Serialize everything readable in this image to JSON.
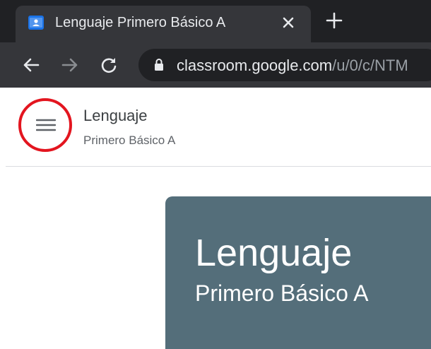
{
  "browser": {
    "tab": {
      "title": "Lenguaje Primero Básico A",
      "favicon": "classroom-icon",
      "close_icon": "close-icon"
    },
    "new_tab_icon": "plus-icon",
    "toolbar": {
      "back_icon": "arrow-left-icon",
      "forward_icon": "arrow-right-icon",
      "reload_icon": "reload-icon",
      "lock_icon": "lock-icon"
    },
    "address": {
      "host": "classroom.google.com",
      "path": "/u/0/c/NTM"
    }
  },
  "header": {
    "menu_icon": "hamburger-menu-icon",
    "highlight_color": "#e3151f",
    "title": "Lenguaje",
    "subtitle": "Primero Básico A"
  },
  "banner": {
    "title": "Lenguaje",
    "subtitle": "Primero Básico A",
    "color": "#546e7a"
  }
}
